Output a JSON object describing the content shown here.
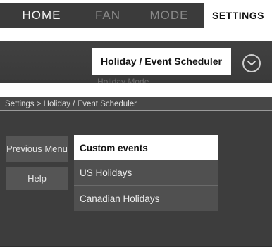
{
  "tabs": {
    "home": "HOME",
    "fan": "FAN",
    "mode": "MODE",
    "settings": "SETTINGS"
  },
  "strip": {
    "current_item": "Holiday / Event Scheduler",
    "next_item_partial": "Holiday Mode"
  },
  "panel": {
    "breadcrumb": "Settings > Holiday / Event Scheduler",
    "previous_menu_label": "Previous Menu",
    "help_label": "Help",
    "menu_items": [
      "Custom events",
      "US Holidays",
      "Canadian Holidays"
    ]
  },
  "colors": {
    "tabbar_bg": "#3b3b3b",
    "selected_bg": "#ffffff",
    "panel_bg": "#3d3d3d"
  }
}
